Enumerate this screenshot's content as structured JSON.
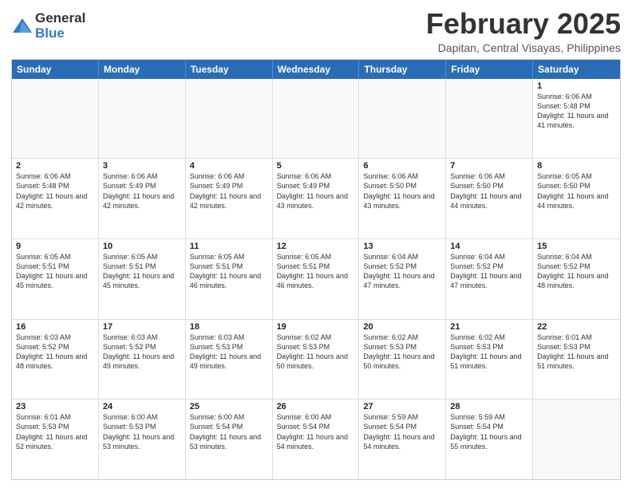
{
  "logo": {
    "general": "General",
    "blue": "Blue"
  },
  "title": "February 2025",
  "location": "Dapitan, Central Visayas, Philippines",
  "days": [
    "Sunday",
    "Monday",
    "Tuesday",
    "Wednesday",
    "Thursday",
    "Friday",
    "Saturday"
  ],
  "weeks": [
    [
      {
        "day": "",
        "text": ""
      },
      {
        "day": "",
        "text": ""
      },
      {
        "day": "",
        "text": ""
      },
      {
        "day": "",
        "text": ""
      },
      {
        "day": "",
        "text": ""
      },
      {
        "day": "",
        "text": ""
      },
      {
        "day": "1",
        "text": "Sunrise: 6:06 AM\nSunset: 5:48 PM\nDaylight: 11 hours and 41 minutes."
      }
    ],
    [
      {
        "day": "2",
        "text": "Sunrise: 6:06 AM\nSunset: 5:48 PM\nDaylight: 11 hours and 42 minutes."
      },
      {
        "day": "3",
        "text": "Sunrise: 6:06 AM\nSunset: 5:49 PM\nDaylight: 11 hours and 42 minutes."
      },
      {
        "day": "4",
        "text": "Sunrise: 6:06 AM\nSunset: 5:49 PM\nDaylight: 11 hours and 42 minutes."
      },
      {
        "day": "5",
        "text": "Sunrise: 6:06 AM\nSunset: 5:49 PM\nDaylight: 11 hours and 43 minutes."
      },
      {
        "day": "6",
        "text": "Sunrise: 6:06 AM\nSunset: 5:50 PM\nDaylight: 11 hours and 43 minutes."
      },
      {
        "day": "7",
        "text": "Sunrise: 6:06 AM\nSunset: 5:50 PM\nDaylight: 11 hours and 44 minutes."
      },
      {
        "day": "8",
        "text": "Sunrise: 6:05 AM\nSunset: 5:50 PM\nDaylight: 11 hours and 44 minutes."
      }
    ],
    [
      {
        "day": "9",
        "text": "Sunrise: 6:05 AM\nSunset: 5:51 PM\nDaylight: 11 hours and 45 minutes."
      },
      {
        "day": "10",
        "text": "Sunrise: 6:05 AM\nSunset: 5:51 PM\nDaylight: 11 hours and 45 minutes."
      },
      {
        "day": "11",
        "text": "Sunrise: 6:05 AM\nSunset: 5:51 PM\nDaylight: 11 hours and 46 minutes."
      },
      {
        "day": "12",
        "text": "Sunrise: 6:05 AM\nSunset: 5:51 PM\nDaylight: 11 hours and 46 minutes."
      },
      {
        "day": "13",
        "text": "Sunrise: 6:04 AM\nSunset: 5:52 PM\nDaylight: 11 hours and 47 minutes."
      },
      {
        "day": "14",
        "text": "Sunrise: 6:04 AM\nSunset: 5:52 PM\nDaylight: 11 hours and 47 minutes."
      },
      {
        "day": "15",
        "text": "Sunrise: 6:04 AM\nSunset: 5:52 PM\nDaylight: 11 hours and 48 minutes."
      }
    ],
    [
      {
        "day": "16",
        "text": "Sunrise: 6:03 AM\nSunset: 5:52 PM\nDaylight: 11 hours and 48 minutes."
      },
      {
        "day": "17",
        "text": "Sunrise: 6:03 AM\nSunset: 5:52 PM\nDaylight: 11 hours and 49 minutes."
      },
      {
        "day": "18",
        "text": "Sunrise: 6:03 AM\nSunset: 5:53 PM\nDaylight: 11 hours and 49 minutes."
      },
      {
        "day": "19",
        "text": "Sunrise: 6:02 AM\nSunset: 5:53 PM\nDaylight: 11 hours and 50 minutes."
      },
      {
        "day": "20",
        "text": "Sunrise: 6:02 AM\nSunset: 5:53 PM\nDaylight: 11 hours and 50 minutes."
      },
      {
        "day": "21",
        "text": "Sunrise: 6:02 AM\nSunset: 5:53 PM\nDaylight: 11 hours and 51 minutes."
      },
      {
        "day": "22",
        "text": "Sunrise: 6:01 AM\nSunset: 5:53 PM\nDaylight: 11 hours and 51 minutes."
      }
    ],
    [
      {
        "day": "23",
        "text": "Sunrise: 6:01 AM\nSunset: 5:53 PM\nDaylight: 11 hours and 52 minutes."
      },
      {
        "day": "24",
        "text": "Sunrise: 6:00 AM\nSunset: 5:53 PM\nDaylight: 11 hours and 53 minutes."
      },
      {
        "day": "25",
        "text": "Sunrise: 6:00 AM\nSunset: 5:54 PM\nDaylight: 11 hours and 53 minutes."
      },
      {
        "day": "26",
        "text": "Sunrise: 6:00 AM\nSunset: 5:54 PM\nDaylight: 11 hours and 54 minutes."
      },
      {
        "day": "27",
        "text": "Sunrise: 5:59 AM\nSunset: 5:54 PM\nDaylight: 11 hours and 54 minutes."
      },
      {
        "day": "28",
        "text": "Sunrise: 5:59 AM\nSunset: 5:54 PM\nDaylight: 11 hours and 55 minutes."
      },
      {
        "day": "",
        "text": ""
      }
    ]
  ]
}
